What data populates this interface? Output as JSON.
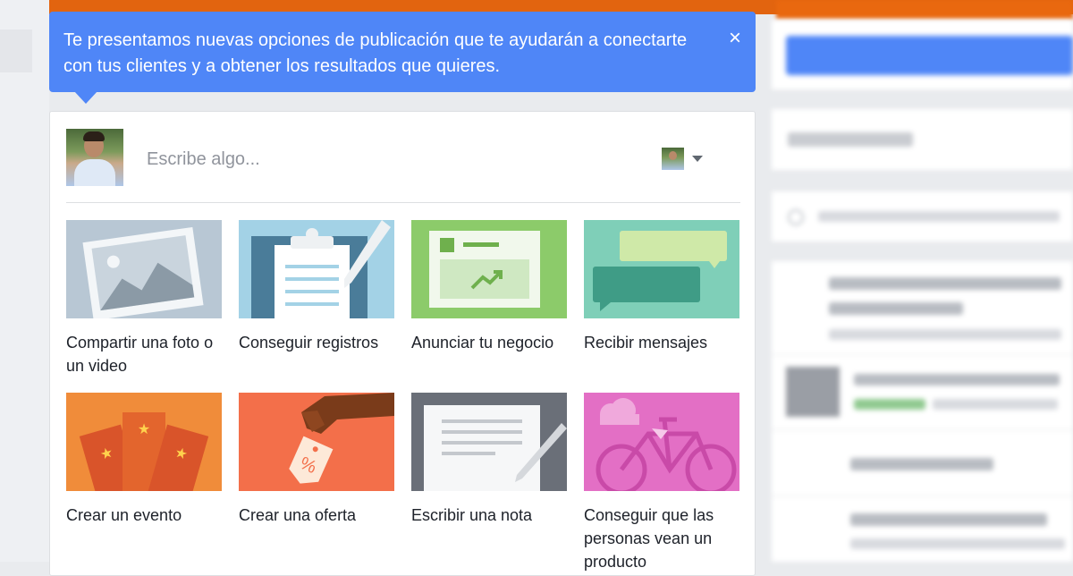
{
  "banner": {
    "text": "Te presentamos nuevas opciones de publicación que te ayudarán a conectarte con tus clientes y a obtener los resultados que quieres.",
    "close_symbol": "×"
  },
  "composer": {
    "placeholder": "Escribe algo...",
    "options": [
      {
        "label": "Compartir una foto o un video",
        "icon": "photo-icon"
      },
      {
        "label": "Conseguir registros",
        "icon": "clipboard-icon"
      },
      {
        "label": "Anunciar tu negocio",
        "icon": "ad-chart-icon"
      },
      {
        "label": "Recibir mensajes",
        "icon": "chat-bubbles-icon"
      },
      {
        "label": "Crear un evento",
        "icon": "tickets-icon"
      },
      {
        "label": "Crear una oferta",
        "icon": "price-tag-icon"
      },
      {
        "label": "Escribir una nota",
        "icon": "note-pen-icon"
      },
      {
        "label": "Conseguir que las personas vean un producto",
        "icon": "bicycle-icon"
      }
    ]
  },
  "colors": {
    "accent_blue": "#4f86f7",
    "top_bar": "#e2640f"
  }
}
